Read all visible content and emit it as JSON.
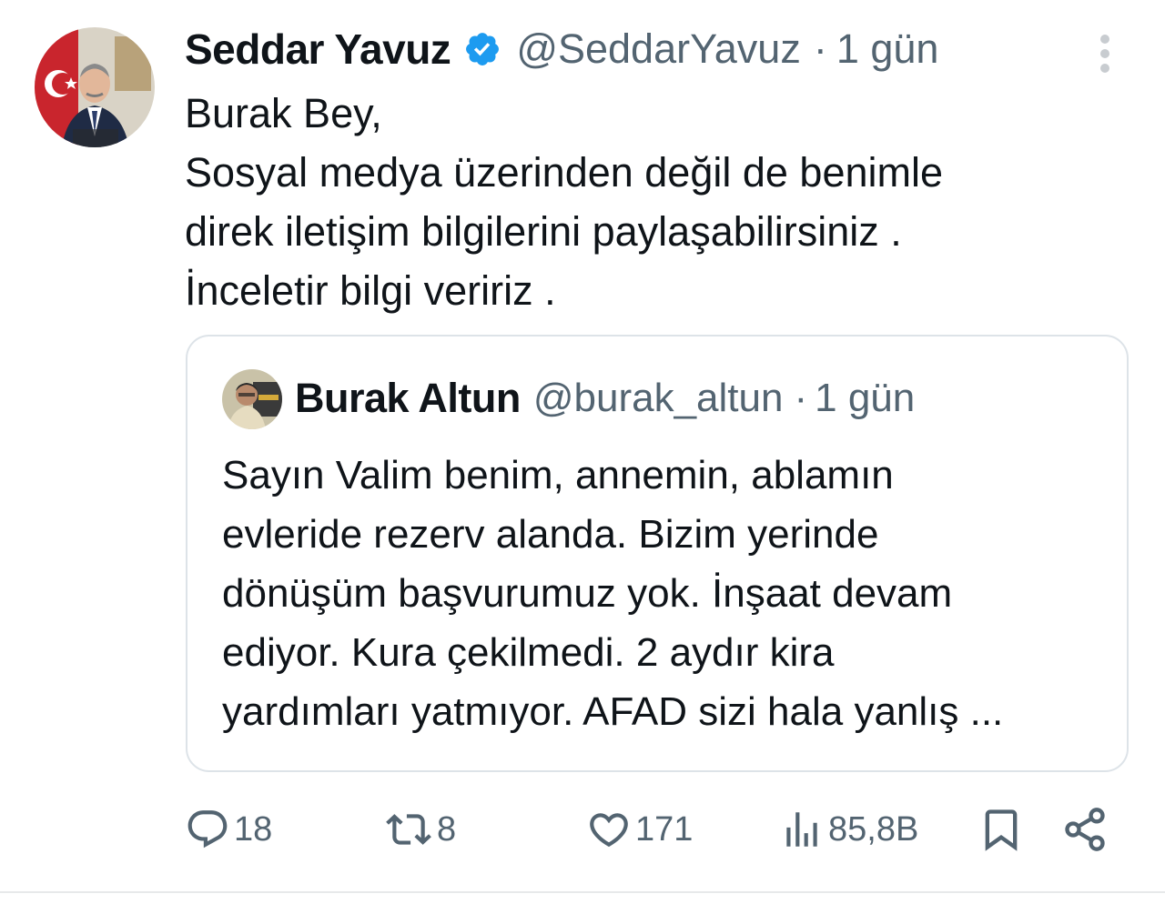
{
  "tweet": {
    "author_name": "Seddar Yavuz",
    "author_handle": "@SeddarYavuz",
    "time_separator": "·",
    "time": "1 gün",
    "text": "Burak Bey,\nSosyal medya üzerinden değil de benimle\ndirek iletişim bilgilerini paylaşabilirsiniz .\nİnceletir bilgi veririz .",
    "verified": true,
    "verified_color": "#1d9bf0"
  },
  "quoted_tweet": {
    "author_name": "Burak Altun",
    "author_handle": "@burak_altun",
    "time_separator": "·",
    "time": "1 gün",
    "text": "Sayın Valim benim, annemin, ablamın\nevleride rezerv alanda. Bizim yerinde\ndönüşüm başvurumuz yok. İnşaat devam\nediyor. Kura çekilmedi. 2 aydır kira\nyardımları yatmıyor. AFAD sizi hala yanlış ..."
  },
  "actions": {
    "replies": "18",
    "retweets": "8",
    "likes": "171",
    "views": "85,8B"
  },
  "colors": {
    "text": "#0f1419",
    "secondary": "#536471",
    "border": "#dde3e8"
  }
}
